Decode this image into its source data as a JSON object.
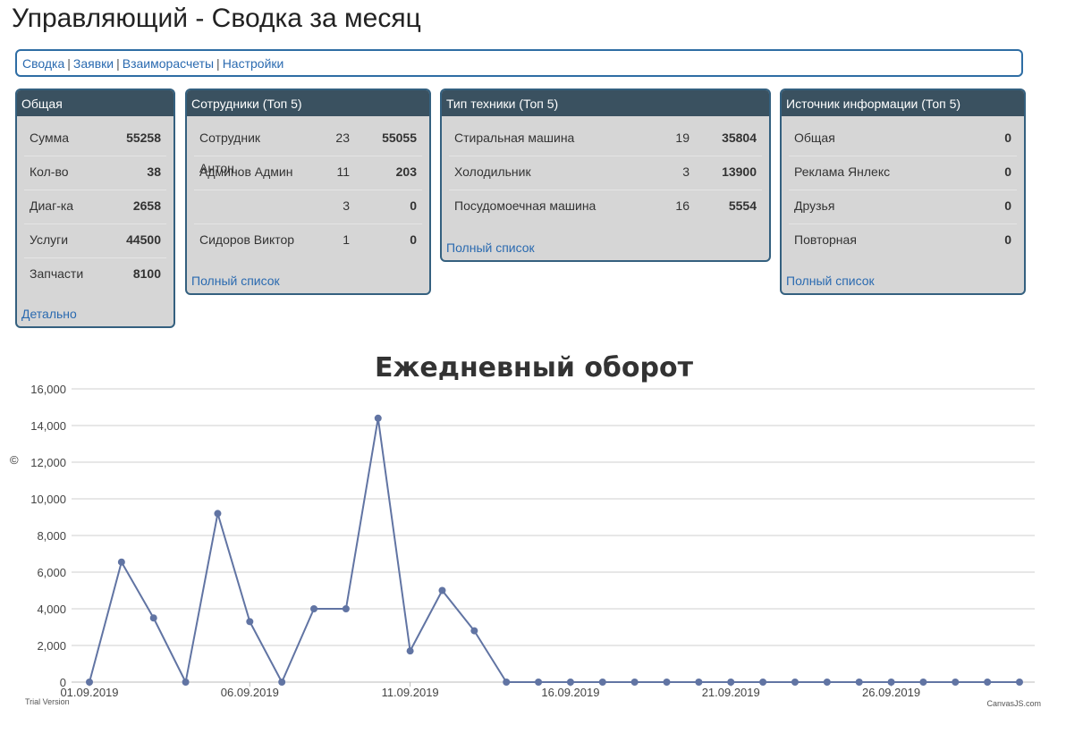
{
  "page": {
    "title": "Управляющий - Сводка за месяц"
  },
  "nav": {
    "items": [
      "Сводка",
      "Заявки",
      "Взаиморасчеты",
      "Настройки"
    ]
  },
  "panels": {
    "general": {
      "title": "Общая",
      "rows": [
        {
          "label": "Сумма",
          "value": "55258"
        },
        {
          "label": "Кол-во",
          "value": "38"
        },
        {
          "label": "Диаг-ка",
          "value": "2658"
        },
        {
          "label": "Услуги",
          "value": "44500"
        },
        {
          "label": "Запчасти",
          "value": "8100"
        }
      ],
      "link": "Детально"
    },
    "staff": {
      "title": "Сотрудники (Топ 5)",
      "rows": [
        {
          "label": "Сотрудник Антон",
          "count": "23",
          "value": "55055"
        },
        {
          "label": "Админов Админ",
          "count": "11",
          "value": "203"
        },
        {
          "label": "",
          "count": "3",
          "value": "0"
        },
        {
          "label": "Сидоров Виктор",
          "count": "1",
          "value": "0"
        }
      ],
      "link": "Полный список"
    },
    "equipment": {
      "title": "Тип техники (Топ 5)",
      "rows": [
        {
          "label": "Стиральная машина",
          "count": "19",
          "value": "35804"
        },
        {
          "label": "Холодильник",
          "count": "3",
          "value": "13900"
        },
        {
          "label": "Посудомоечная машина",
          "count": "16",
          "value": "5554"
        }
      ],
      "link": "Полный список"
    },
    "source": {
      "title": "Источник информации (Топ 5)",
      "rows": [
        {
          "label": "Общая",
          "value": "0"
        },
        {
          "label": "Реклама Янлекс",
          "value": "0"
        },
        {
          "label": "Друзья",
          "value": "0"
        },
        {
          "label": "Повторная",
          "value": "0"
        }
      ],
      "link": "Полный список"
    }
  },
  "chart_data": {
    "type": "line",
    "title": "Ежедневный оборот",
    "xlabel": "",
    "ylabel": "",
    "x": [
      "01.09.2019",
      "02.09.2019",
      "03.09.2019",
      "04.09.2019",
      "05.09.2019",
      "06.09.2019",
      "07.09.2019",
      "08.09.2019",
      "09.09.2019",
      "10.09.2019",
      "11.09.2019",
      "12.09.2019",
      "13.09.2019",
      "14.09.2019",
      "15.09.2019",
      "16.09.2019",
      "17.09.2019",
      "18.09.2019",
      "19.09.2019",
      "20.09.2019",
      "21.09.2019",
      "22.09.2019",
      "23.09.2019",
      "24.09.2019",
      "25.09.2019",
      "26.09.2019",
      "27.09.2019",
      "28.09.2019",
      "29.09.2019",
      "30.09.2019"
    ],
    "values": [
      0,
      6550,
      3500,
      0,
      9200,
      3300,
      0,
      4000,
      4000,
      14400,
      1700,
      5000,
      2800,
      0,
      0,
      0,
      0,
      0,
      0,
      0,
      0,
      0,
      0,
      0,
      0,
      0,
      0,
      0,
      0,
      0
    ],
    "x_tick_labels": [
      "01.09.2019",
      "06.09.2019",
      "11.09.2019",
      "16.09.2019",
      "21.09.2019",
      "26.09.2019"
    ],
    "y_tick_labels": [
      "0",
      "2,000",
      "4,000",
      "6,000",
      "8,000",
      "10,000",
      "12,000",
      "14,000",
      "16,000"
    ],
    "ylim": [
      0,
      16000
    ],
    "grid": true,
    "legend": "none",
    "line_color": "#6174a3",
    "watermark_left": "Trial Version",
    "watermark_right": "CanvasJS.com",
    "copyright_symbol": "©"
  }
}
